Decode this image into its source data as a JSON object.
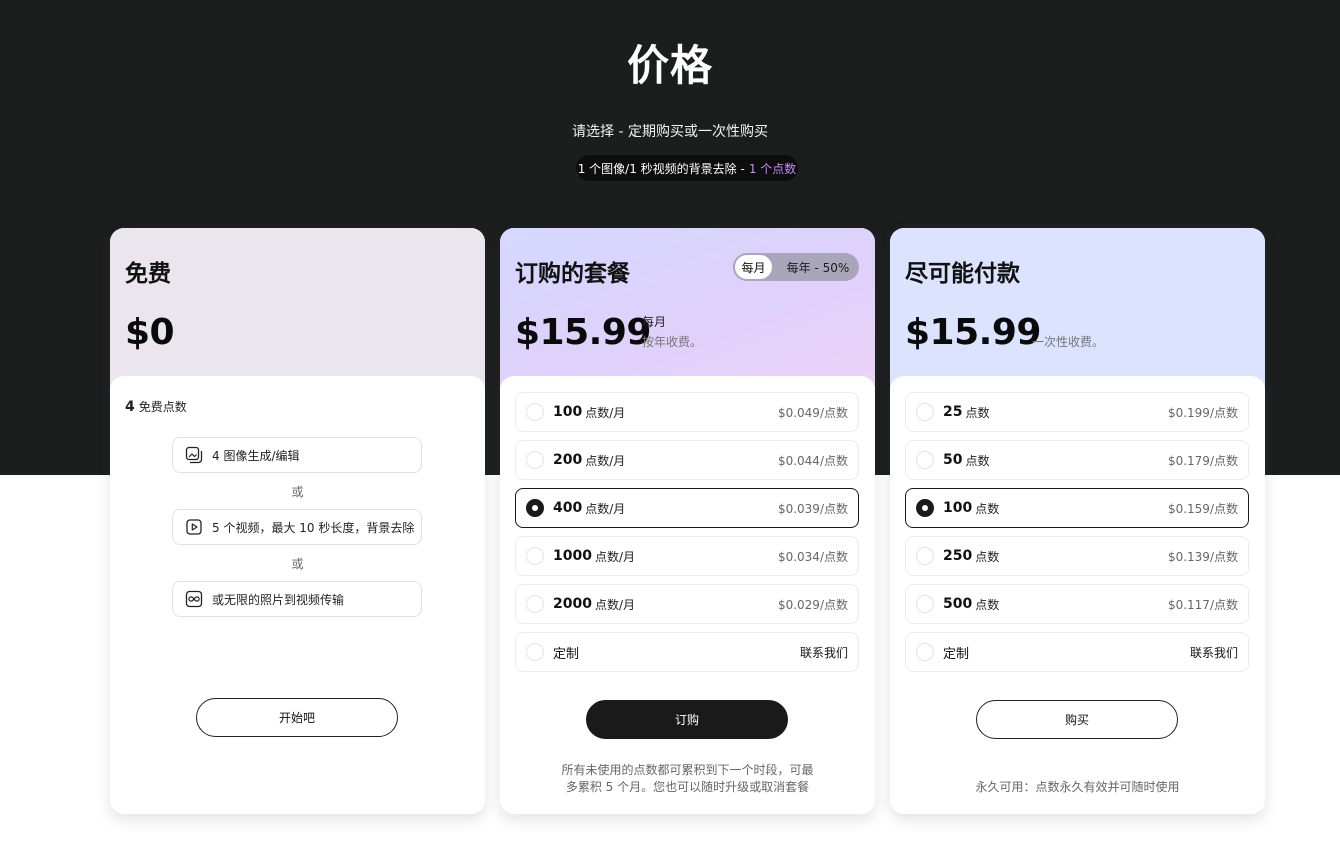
{
  "header": {
    "title": "价格",
    "subtitle": "请选择 - 定期购买或一次性购买",
    "credit_note": "1 个图像/1 秒视频的背景去除 -",
    "credit_accent": "1 个点数"
  },
  "colors": {
    "hero_bg": "#1c1d1d",
    "accent_purple": "#c48cff",
    "free_card": "#ebe6ee",
    "sub_card_start": "#d4d8ff",
    "sub_card_end": "#ecd2f7",
    "once_card": "#dbe3fe",
    "button_dark": "#1a1a1a"
  },
  "free": {
    "title": "免费",
    "price": "$0",
    "credits_num": "4",
    "credits_label": "免费点数",
    "features": [
      {
        "icon": "image-edit-icon",
        "label": "4 图像生成/编辑"
      },
      {
        "icon": "play-video-icon",
        "label": "5 个视频，最大 10 秒长度，背景去除"
      },
      {
        "icon": "infinity-icon",
        "label": "或无限的照片到视频传输"
      }
    ],
    "or_label": "或",
    "button": "开始吧"
  },
  "subscription": {
    "title": "订购的套餐",
    "toggle": {
      "monthly": "每月",
      "yearly": "每年 - 50%"
    },
    "price": "$15.99",
    "price_period": "每月",
    "price_billing": "按年收费。",
    "plans": [
      {
        "amount": "100",
        "unit": "点数/月",
        "rate": "$0.049/点数",
        "selected": false
      },
      {
        "amount": "200",
        "unit": "点数/月",
        "rate": "$0.044/点数",
        "selected": false
      },
      {
        "amount": "400",
        "unit": "点数/月",
        "rate": "$0.039/点数",
        "selected": true
      },
      {
        "amount": "1000",
        "unit": "点数/月",
        "rate": "$0.034/点数",
        "selected": false
      },
      {
        "amount": "2000",
        "unit": "点数/月",
        "rate": "$0.029/点数",
        "selected": false
      }
    ],
    "custom": {
      "label": "定制",
      "contact": "联系我们"
    },
    "button": "订购",
    "note_line1": "所有未使用的点数都可累积到下一个时段，可最",
    "note_line2": "多累积 5 个月。您也可以随时升级或取消套餐"
  },
  "one_time": {
    "title": "尽可能付款",
    "price": "$15.99",
    "price_billing": "一次性收费。",
    "plans": [
      {
        "amount": "25",
        "unit": "点数",
        "rate": "$0.199/点数",
        "selected": false
      },
      {
        "amount": "50",
        "unit": "点数",
        "rate": "$0.179/点数",
        "selected": false
      },
      {
        "amount": "100",
        "unit": "点数",
        "rate": "$0.159/点数",
        "selected": true
      },
      {
        "amount": "250",
        "unit": "点数",
        "rate": "$0.139/点数",
        "selected": false
      },
      {
        "amount": "500",
        "unit": "点数",
        "rate": "$0.117/点数",
        "selected": false
      }
    ],
    "custom": {
      "label": "定制",
      "contact": "联系我们"
    },
    "button": "购买",
    "note": "永久可用：点数永久有效并可随时使用"
  }
}
